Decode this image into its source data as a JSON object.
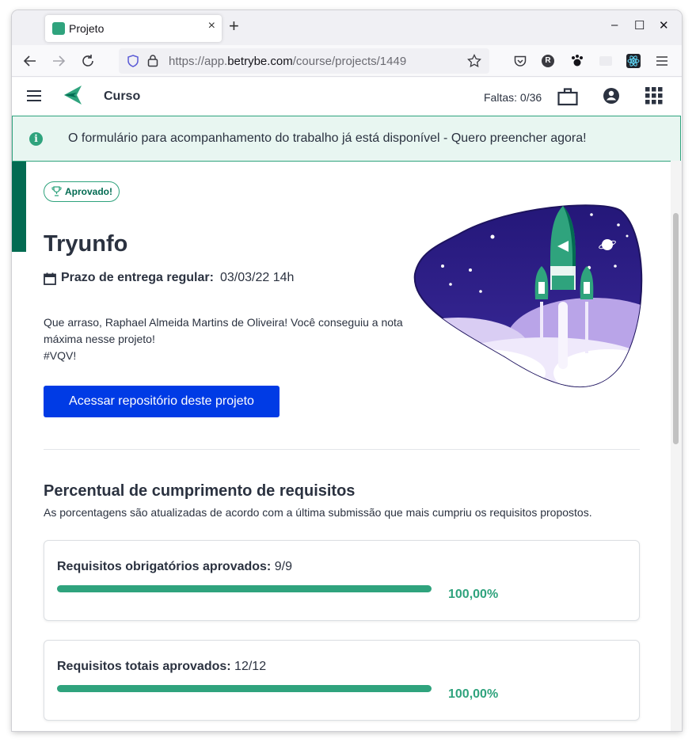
{
  "browser": {
    "tab_title": "Projeto",
    "tab_close": "×",
    "new_tab": "+",
    "url_prefix": "https://app.",
    "url_domain": "betrybe.com",
    "url_path": "/course/projects/1449",
    "window_controls": [
      "–",
      "☐",
      "✕"
    ],
    "extensions": [
      "R"
    ]
  },
  "header": {
    "section": "Curso",
    "faltas": "Faltas: 0/36"
  },
  "banner": {
    "text": "O formulário para acompanhamento do trabalho já está disponível - Quero preencher agora!"
  },
  "project": {
    "badge": "Aprovado!",
    "title": "Tryunfo",
    "deadline_label": "Prazo de entrega regular:",
    "deadline_value": "03/03/22 14h",
    "message_line1": "Que arraso, Raphael Almeida Martins de Oliveira! Você conseguiu a nota máxima nesse projeto!",
    "message_line2": "#VQV!",
    "cta": "Acessar repositório deste projeto"
  },
  "requirements": {
    "title": "Percentual de cumprimento de requisitos",
    "subtitle": "As porcentagens são atualizadas de acordo com a última submissão que mais cumpriu os requisitos propostos.",
    "items": [
      {
        "label": "Requisitos obrigatórios aprovados:",
        "value": "9/9",
        "percent_text": "100,00%",
        "fraction": 1.0
      },
      {
        "label": "Requisitos totais aprovados:",
        "value": "12/12",
        "percent_text": "100,00%",
        "fraction": 1.0
      }
    ]
  },
  "colors": {
    "accent_green": "#2fa37d",
    "dark_green": "#036b52",
    "button_blue": "#003be5",
    "illustration_purple": "#2b1a7c"
  }
}
